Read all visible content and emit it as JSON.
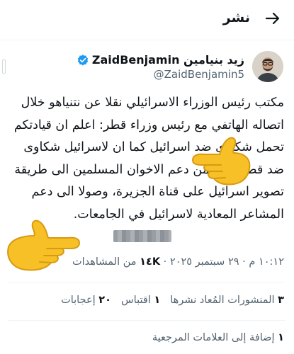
{
  "header": {
    "title": "نشر"
  },
  "author": {
    "display_name": "زيد بنيامين ZaidBenjamin",
    "handle": "@ZaidBenjamin5"
  },
  "tweet": {
    "lines": [
      "مكتب رئيس الوزراء الاسرائيلي نقلا عن نتنياهو خلال",
      "اتصاله الهاتفي مع رئيس وزراء قطر: اعلم ان قيادتكم",
      "تحمل شكاوى ضد اسرائيل كما ان لاسرائيل شكاوى",
      "ضد قطر، بدءا من دعم الاخوان المسلمين الى طريقة",
      "تصوير اسرائيل على قناة الجزيرة، وصولا الى دعم",
      "المشاعر المعادية لاسرائيل في الجامعات."
    ]
  },
  "meta": {
    "time_date": "١٠:١٢ م · ٢٩ سبتمبر ٢٠٢٥ · ",
    "views_count": "١٤K",
    "views_label": " من المشاهدات"
  },
  "stats": {
    "reposts_count": "٣",
    "reposts_label": " المنشورات المُعاد نشرها",
    "quotes_count": "١",
    "quotes_label": " اقتباس",
    "likes_count": "٢٠",
    "likes_label": " إعجابات"
  },
  "bookmarks": {
    "count": "١",
    "label": " إضافة إلى العلامات المرجعية"
  },
  "colors": {
    "verified": "#1d9bf0",
    "emoji": "#f6c026"
  }
}
